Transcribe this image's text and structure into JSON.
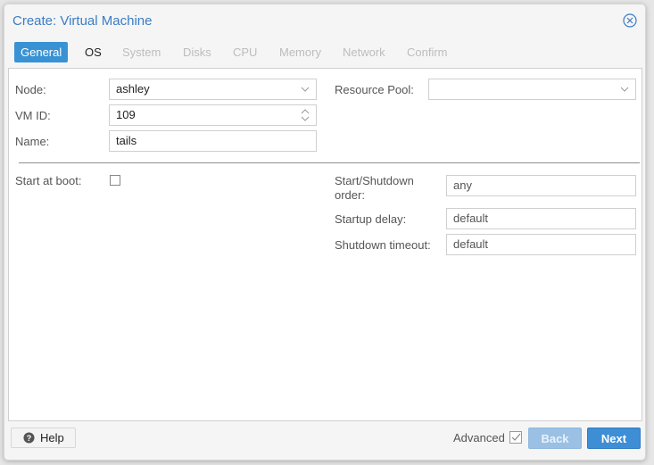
{
  "window": {
    "title": "Create: Virtual Machine",
    "close_icon": "close-circle-icon"
  },
  "tabs": [
    {
      "label": "General",
      "state": "active"
    },
    {
      "label": "OS",
      "state": "enabled"
    },
    {
      "label": "System",
      "state": "disabled"
    },
    {
      "label": "Disks",
      "state": "disabled"
    },
    {
      "label": "CPU",
      "state": "disabled"
    },
    {
      "label": "Memory",
      "state": "disabled"
    },
    {
      "label": "Network",
      "state": "disabled"
    },
    {
      "label": "Confirm",
      "state": "disabled"
    }
  ],
  "form": {
    "node": {
      "label": "Node:",
      "value": "ashley"
    },
    "vmid": {
      "label": "VM ID:",
      "value": "109"
    },
    "name": {
      "label": "Name:",
      "value": "tails"
    },
    "resource_pool": {
      "label": "Resource Pool:",
      "value": ""
    },
    "start_at_boot": {
      "label": "Start at boot:",
      "checked": false
    },
    "start_shutdown_order": {
      "label_line1": "Start/Shutdown",
      "label_line2": "order:",
      "placeholder": "any"
    },
    "startup_delay": {
      "label": "Startup delay:",
      "placeholder": "default"
    },
    "shutdown_timeout": {
      "label": "Shutdown timeout:",
      "placeholder": "default"
    }
  },
  "footer": {
    "help_label": "Help",
    "advanced_label": "Advanced",
    "advanced_checked": true,
    "back_label": "Back",
    "back_enabled": false,
    "next_label": "Next"
  },
  "colors": {
    "accent": "#3892d4",
    "title": "#3b7cc4",
    "next_button": "#3e8ed6",
    "back_button_disabled": "#9ac0e3"
  }
}
